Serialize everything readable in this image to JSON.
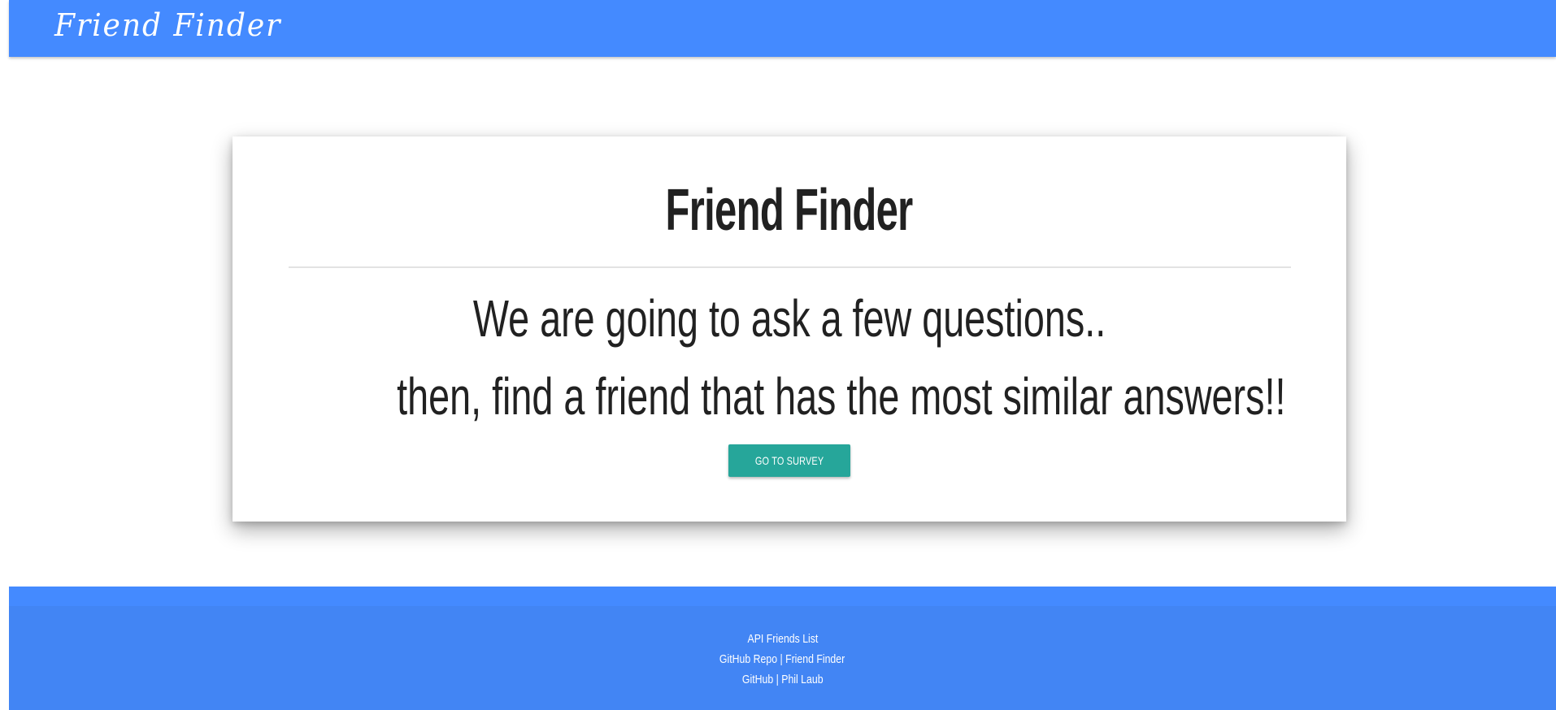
{
  "navbar": {
    "brand": "Friend Finder"
  },
  "card": {
    "title": "Friend Finder",
    "line1": "We are going to ask a few questions..",
    "line2": "then, find a friend that has the most similar answers!!",
    "button_label": "GO TO SURVEY"
  },
  "footer": {
    "api_link": "API Friends List",
    "repo_link": "GitHub Repo | Friend Finder",
    "profile_link": "GitHub | Phil Laub"
  },
  "colors": {
    "navbar": "#448aff",
    "footer": "#4285f4",
    "button": "#26a69a",
    "text": "#212121"
  }
}
